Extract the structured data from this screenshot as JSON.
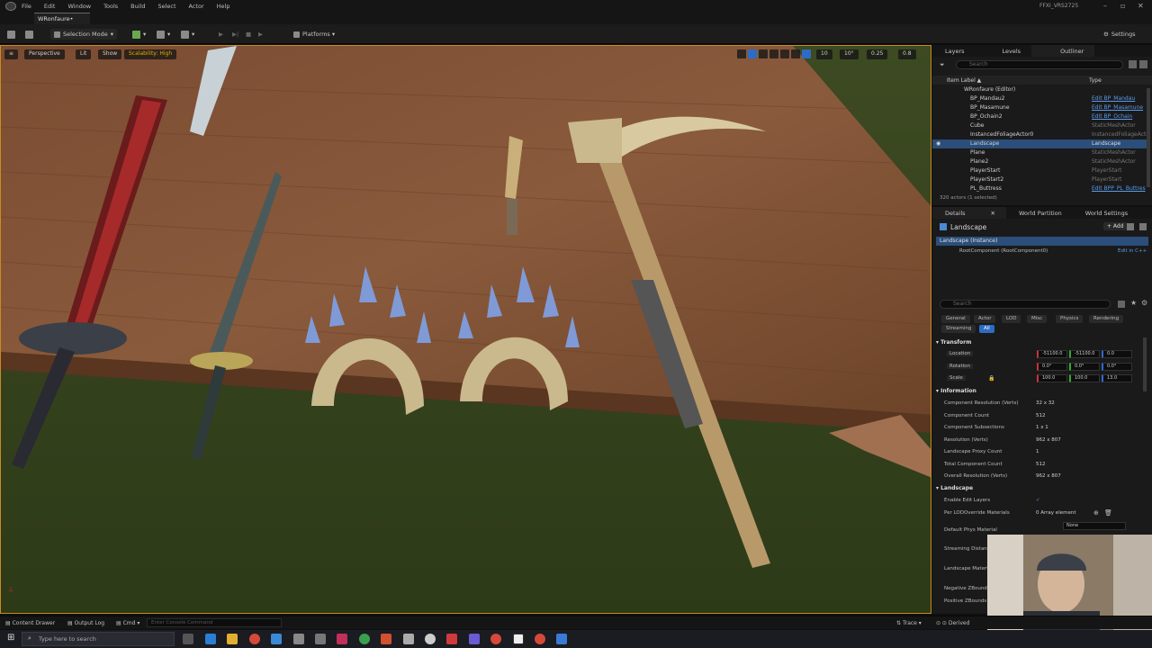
{
  "menu": {
    "items": [
      "File",
      "Edit",
      "Window",
      "Tools",
      "Build",
      "Select",
      "Actor",
      "Help"
    ],
    "project_name": "FFXI_VRS2725"
  },
  "level_tab": "WRonfaure•",
  "toolbar": {
    "selection_mode": "Selection Mode",
    "platforms": "Platforms",
    "settings": "Settings"
  },
  "viewport": {
    "perspective": "Perspective",
    "lit": "Lit",
    "show": "Show",
    "scalability": "Scalability: High",
    "snap_value": "10",
    "rotation_snap": "10°",
    "scale_snap": "0.25",
    "camera_speed": "0.8"
  },
  "outliner": {
    "tabs": [
      "Layers",
      "Levels",
      "Outliner"
    ],
    "search_placeholder": "Search",
    "col_label": "Item Label ▲",
    "col_type": "Type",
    "rows": [
      {
        "name": "WRonfaure (Editor)",
        "type": ""
      },
      {
        "name": "BP_Mandau2",
        "type": "Edit BP_Mandau"
      },
      {
        "name": "BP_Masamune",
        "type": "Edit BP_Masamune"
      },
      {
        "name": "BP_Ochain2",
        "type": "Edit BP_Ochain"
      },
      {
        "name": "Cube",
        "type": "StaticMeshActor"
      },
      {
        "name": "InstancedFoliageActor0",
        "type": "InstancedFoliageActo"
      },
      {
        "name": "Landscape",
        "type": "Landscape"
      },
      {
        "name": "Plane",
        "type": "StaticMeshActor"
      },
      {
        "name": "Plane2",
        "type": "StaticMeshActor"
      },
      {
        "name": "PlayerStart",
        "type": "PlayerStart"
      },
      {
        "name": "PlayerStart2",
        "type": "PlayerStart"
      },
      {
        "name": "PL_Buttress",
        "type": "Edit BPP_PL_Buttres"
      }
    ],
    "actor_count": "320 actors (1 selected)"
  },
  "details": {
    "tabs": [
      "Details",
      "World Partition",
      "World Settings"
    ],
    "actor_name": "Landscape",
    "add_label": "+ Add",
    "instance_row": "Landscape (Instance)",
    "root_component": "RootComponent (RootComponent0)",
    "edit_cpp": "Edit in C++",
    "search_placeholder": "Search",
    "filter_chips": [
      "General",
      "Actor",
      "LOD",
      "Misc",
      "Physics",
      "Rendering",
      "Streaming",
      "All"
    ],
    "transform_header": "Transform",
    "transform": [
      {
        "label": "Location",
        "x": "-51100.0",
        "y": "-51100.0",
        "z": "0.0"
      },
      {
        "label": "Rotation",
        "x": "0.0°",
        "y": "0.0°",
        "z": "0.0°"
      },
      {
        "label": "Scale",
        "x": "100.0",
        "y": "100.0",
        "z": "13.0"
      }
    ],
    "information_header": "Information",
    "information": [
      {
        "label": "Component Resolution (Verts)",
        "value": "32 x 32"
      },
      {
        "label": "Component Count",
        "value": "512"
      },
      {
        "label": "Component Subsections",
        "value": "1 x 1"
      },
      {
        "label": "Resolution (Verts)",
        "value": "962 x 807"
      },
      {
        "label": "Landscape Proxy Count",
        "value": "1"
      },
      {
        "label": "Total Component Count",
        "value": "512"
      },
      {
        "label": "Overall Resolution (Verts)",
        "value": "962 x 807"
      }
    ],
    "landscape_header": "Landscape",
    "landscape_props": [
      {
        "label": "Enable Edit Layers",
        "value": "✓"
      },
      {
        "label": "Per LODOverride Materials",
        "value": "0 Array element"
      },
      {
        "label": "Default Phys Material",
        "value": "None"
      },
      {
        "label": "Streaming Distance",
        "value": ""
      },
      {
        "label": "Landscape Material",
        "value": ""
      },
      {
        "label": "Negative ZBounds E",
        "value": ""
      },
      {
        "label": "Positive ZBounds E",
        "value": ""
      }
    ]
  },
  "statusbar": {
    "content_drawer": "Content Drawer",
    "output_log": "Output Log",
    "cmd": "Cmd",
    "console_placeholder": "Enter Console Command",
    "trace": "Trace",
    "derived": "Derived"
  },
  "taskbar": {
    "search_placeholder": "Type here to search"
  },
  "colors": {
    "selection_outline": "#c98b1e",
    "selected_row": "#2b4e7a",
    "link": "#5a9be8",
    "all_chip": "#2c6cc4"
  }
}
